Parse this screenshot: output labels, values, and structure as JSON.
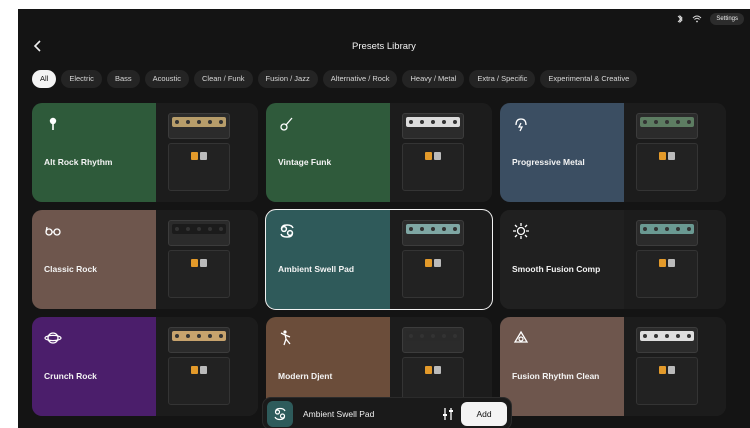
{
  "status": {
    "settings_label": "Settings"
  },
  "header": {
    "title": "Presets Library"
  },
  "tabs": [
    {
      "label": "All",
      "active": true
    },
    {
      "label": "Electric"
    },
    {
      "label": "Bass"
    },
    {
      "label": "Acoustic"
    },
    {
      "label": "Clean / Funk"
    },
    {
      "label": "Fusion / Jazz"
    },
    {
      "label": "Alternative / Rock"
    },
    {
      "label": "Heavy / Metal"
    },
    {
      "label": "Extra / Specific"
    },
    {
      "label": "Experimental & Creative"
    }
  ],
  "presets": [
    {
      "name": "Alt Rock Rhythm",
      "color": "#2e5a3a",
      "icon": "microphone-icon",
      "amp_color": "#b79d6a"
    },
    {
      "name": "Vintage Funk",
      "color": "#2f5a3b",
      "icon": "guitar-icon",
      "amp_color": "#dcdcdc"
    },
    {
      "name": "Progressive Metal",
      "color": "#3b4e62",
      "icon": "lightning-icon",
      "amp_color": "#5d7d62"
    },
    {
      "name": "Classic Rock",
      "color": "#6e564d",
      "icon": "glasses-icon",
      "amp_color": "#1b1b1b"
    },
    {
      "name": "Ambient Swell Pad",
      "color": "#2f5a5a",
      "icon": "cancer-icon",
      "amp_color": "#7fa7a4",
      "selected": true
    },
    {
      "name": "Smooth Fusion Comp",
      "color": "#202020",
      "icon": "sun-icon",
      "amp_color": "#6a9992"
    },
    {
      "name": "Crunch Rock",
      "color": "#4b1e6b",
      "icon": "saturn-icon",
      "amp_color": "#c7a36d"
    },
    {
      "name": "Modern Djent",
      "color": "#6b4d3a",
      "icon": "dancer-icon",
      "amp_color": "#2a2a2a"
    },
    {
      "name": "Fusion Rhythm Clean",
      "color": "#6e564d",
      "icon": "recycle-icon",
      "amp_color": "#dedede"
    }
  ],
  "bottom_bar": {
    "preset_name": "Ambient Swell Pad",
    "add_label": "Add"
  }
}
